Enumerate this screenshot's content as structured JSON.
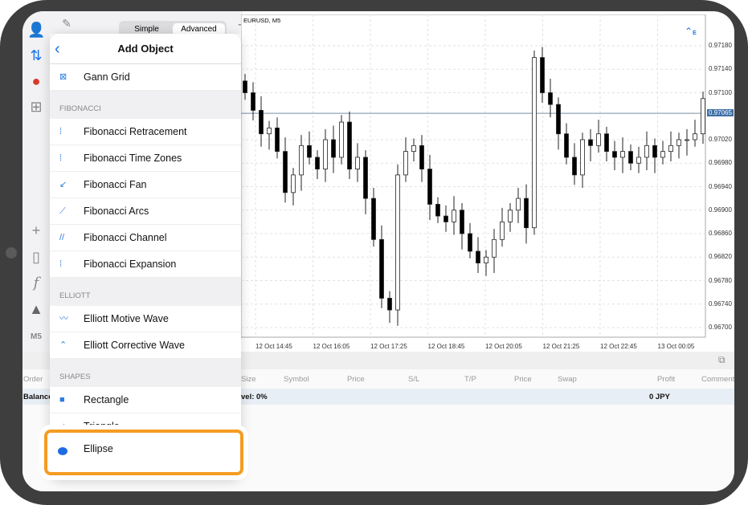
{
  "toolbar": {
    "simple": "Simple",
    "advanced": "Advanced",
    "timeframe": "M5"
  },
  "chart": {
    "symbol": "EURUSD, M5",
    "current_price": "0.97065",
    "indicator_badge": "E",
    "y_ticks": [
      "0.97180",
      "0.97140",
      "0.97100",
      "0.97020",
      "0.96980",
      "0.96940",
      "0.96900",
      "0.96860",
      "0.96820",
      "0.96780",
      "0.96740",
      "0.96700"
    ],
    "x_ticks": [
      "12 Oct 14:45",
      "12 Oct 16:05",
      "12 Oct 17:25",
      "12 Oct 18:45",
      "12 Oct 20:05",
      "12 Oct 21:25",
      "12 Oct 22:45",
      "13 Oct 00:05"
    ],
    "closes": [
      0.971,
      0.9707,
      0.9703,
      0.9704,
      0.97,
      0.9693,
      0.9696,
      0.9701,
      0.9699,
      0.9697,
      0.9702,
      0.9699,
      0.9705,
      0.9697,
      0.9699,
      0.9692,
      0.9685,
      0.9675,
      0.9673,
      0.9696,
      0.97,
      0.9701,
      0.9697,
      0.9691,
      0.9689,
      0.9688,
      0.969,
      0.9686,
      0.9683,
      0.9681,
      0.9682,
      0.9685,
      0.9688,
      0.969,
      0.9692,
      0.9687,
      0.9716,
      0.971,
      0.9708,
      0.9703,
      0.9699,
      0.9696,
      0.9702,
      0.9701,
      0.9703,
      0.97,
      0.9699,
      0.97,
      0.9698,
      0.9699,
      0.9701,
      0.9699,
      0.97,
      0.9701,
      0.9702,
      0.9702,
      0.9703,
      0.9709
    ]
  },
  "table": {
    "headers": [
      "Order",
      "Size",
      "Symbol",
      "Price",
      "S/L",
      "T/P",
      "Price",
      "Swap",
      "Profit",
      "Comment"
    ],
    "balance_label": "Balance",
    "level_text": "vel: 0%",
    "profit": "0  JPY"
  },
  "panel": {
    "title": "Add Object",
    "top_item": "Gann Grid",
    "sections": [
      {
        "title": "FIBONACCI",
        "items": [
          "Fibonacci Retracement",
          "Fibonacci Time Zones",
          "Fibonacci Fan",
          "Fibonacci Arcs",
          "Fibonacci Channel",
          "Fibonacci Expansion"
        ]
      },
      {
        "title": "ELLIOTT",
        "items": [
          "Elliott Motive Wave",
          "Elliott Corrective Wave"
        ]
      },
      {
        "title": "SHAPES",
        "items": [
          "Rectangle",
          "Triangle"
        ]
      }
    ],
    "highlighted_item": "Ellipse"
  },
  "colors": {
    "accent": "#1a73e8",
    "highlight": "#f59c21",
    "price_tag": "#3d6fa6"
  }
}
